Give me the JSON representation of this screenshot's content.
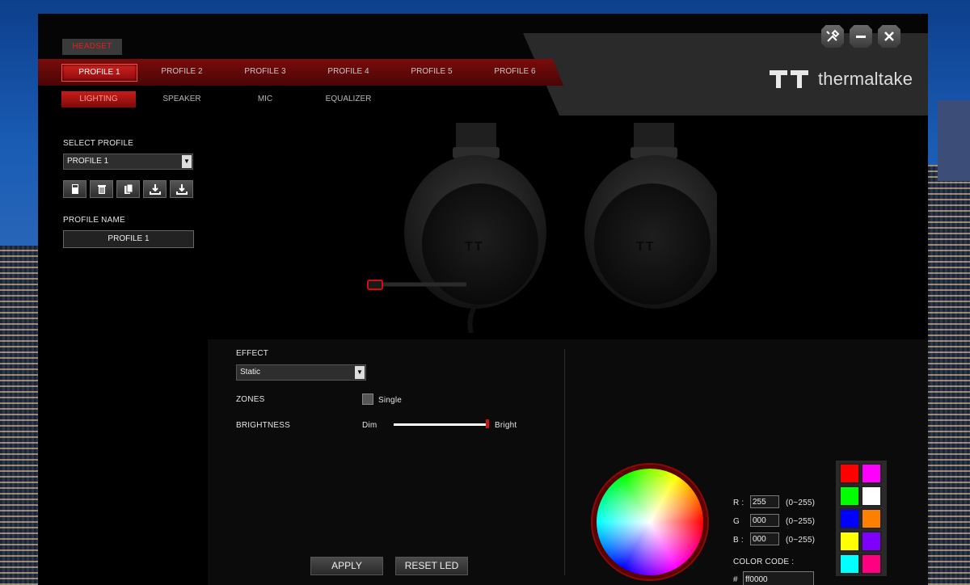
{
  "device_tab": "HEADSET",
  "window_buttons": [
    "tools-icon",
    "minimize-icon",
    "close-icon"
  ],
  "brand": {
    "name": "thermaltake"
  },
  "profiles": [
    {
      "label": "PROFILE 1",
      "active": true
    },
    {
      "label": "PROFILE 2",
      "active": false
    },
    {
      "label": "PROFILE 3",
      "active": false
    },
    {
      "label": "PROFILE 4",
      "active": false
    },
    {
      "label": "PROFILE 5",
      "active": false
    },
    {
      "label": "PROFILE 6",
      "active": false
    }
  ],
  "subtabs": [
    {
      "label": "LIGHTING",
      "active": true
    },
    {
      "label": "SPEAKER",
      "active": false
    },
    {
      "label": "MIC",
      "active": false
    },
    {
      "label": "EQUALIZER",
      "active": false
    }
  ],
  "left": {
    "select_profile_label": "SELECT PROFILE",
    "select_profile_value": "PROFILE 1",
    "profile_actions": [
      "save-icon",
      "delete-icon",
      "copy-icon",
      "import-icon",
      "export-icon"
    ],
    "profile_name_label": "PROFILE NAME",
    "profile_name_value": "PROFILE 1"
  },
  "lighting": {
    "effect_label": "EFFECT",
    "effect_value": "Static",
    "zones_label": "ZONES",
    "zones_option": "Single",
    "brightness_label": "BRIGHTNESS",
    "dim_label": "Dim",
    "bright_label": "Bright",
    "brightness_level": 1.0,
    "apply_label": "APPLY",
    "reset_label": "RESET LED"
  },
  "color": {
    "r_label": "R :",
    "r_value": "255",
    "r_range": "(0~255)",
    "g_label": "G",
    "g_value": "000",
    "g_range": "(0~255)",
    "b_label": "B :",
    "b_value": "000",
    "b_range": "(0~255)",
    "code_label": "COLOR CODE :",
    "hash": "#",
    "code_value": "ff0000",
    "swatches": [
      "#ff0000",
      "#ff00ff",
      "#00ff00",
      "#ffffff",
      "#0000ff",
      "#ff7f00",
      "#ffff00",
      "#7f00ff",
      "#00ffff",
      "#ff0080"
    ]
  },
  "headset_logo": "TT"
}
